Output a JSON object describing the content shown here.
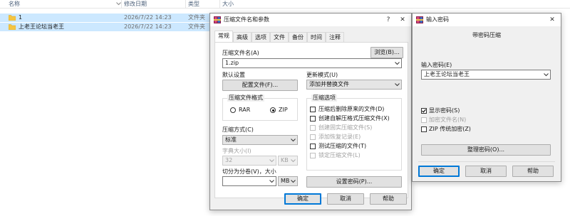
{
  "explorer": {
    "columns": {
      "name": "名称",
      "date": "修改日期",
      "type": "类型",
      "size": "大小"
    },
    "rows": [
      {
        "name": "1",
        "date": "2026/7/22 14:23",
        "type": "文件夹"
      },
      {
        "name": "上老王论坛当老王",
        "date": "2026/7/22 14:23",
        "type": "文件夹"
      }
    ]
  },
  "archive_dialog": {
    "title": "压缩文件名和参数",
    "help_glyph": "?",
    "close_glyph": "✕",
    "tabs": [
      "常规",
      "高级",
      "选项",
      "文件",
      "备份",
      "时间",
      "注释"
    ],
    "archive_name_label": "压缩文件名(A)",
    "browse_button": "浏览(B)...",
    "archive_name_value": "1.zip",
    "default_settings_label": "默认设置",
    "profiles_button": "配置文件(F)...",
    "update_mode_label": "更新模式(U)",
    "update_mode_value": "添加并替换文件",
    "format_group_title": "压缩文件格式",
    "format_rar": "RAR",
    "format_zip": "ZIP",
    "format_selected": "ZIP",
    "method_label": "压缩方式(C)",
    "method_value": "标准",
    "dict_label": "字典大小(I)",
    "dict_value": "32",
    "dict_unit": "KB",
    "split_label": "切分为分卷(V)，大小",
    "split_value": "",
    "split_unit": "MB",
    "options_group_title": "压缩选项",
    "options": [
      {
        "label": "压缩后删除原来的文件(D)",
        "checked": false,
        "enabled": true
      },
      {
        "label": "创建自解压格式压缩文件(X)",
        "checked": false,
        "enabled": true
      },
      {
        "label": "创建固实压缩文件(S)",
        "checked": false,
        "enabled": false
      },
      {
        "label": "添加恢复记录(E)",
        "checked": false,
        "enabled": false
      },
      {
        "label": "测试压缩的文件(T)",
        "checked": false,
        "enabled": true
      },
      {
        "label": "锁定压缩文件(L)",
        "checked": false,
        "enabled": false
      }
    ],
    "set_password_button": "设置密码(P)...",
    "ok_button": "确定",
    "cancel_button": "取消",
    "help_button": "帮助"
  },
  "password_dialog": {
    "title": "输入密码",
    "close_glyph": "✕",
    "heading": "带密码压缩",
    "password_label": "输入密码(E)",
    "password_value": "上老王论坛当老王",
    "show_password": {
      "label": "显示密码(S)",
      "checked": true,
      "enabled": true
    },
    "encrypt_names": {
      "label": "加密文件名(N)",
      "checked": false,
      "enabled": false
    },
    "zip_legacy": {
      "label": "ZIP 传统加密(Z)",
      "checked": false,
      "enabled": true
    },
    "organize_button": "整理密码(O)...",
    "ok_button": "确定",
    "cancel_button": "取消",
    "help_button": "帮助"
  },
  "colors": {
    "selection": "#cce8ff",
    "accent": "#0078d7",
    "dialog_bg": "#f0f0f0"
  },
  "icons": {
    "folder": "folder-icon",
    "winrar": "winrar-icon",
    "chevron": "chevron-down-icon",
    "close": "close-icon",
    "help": "help-icon"
  }
}
